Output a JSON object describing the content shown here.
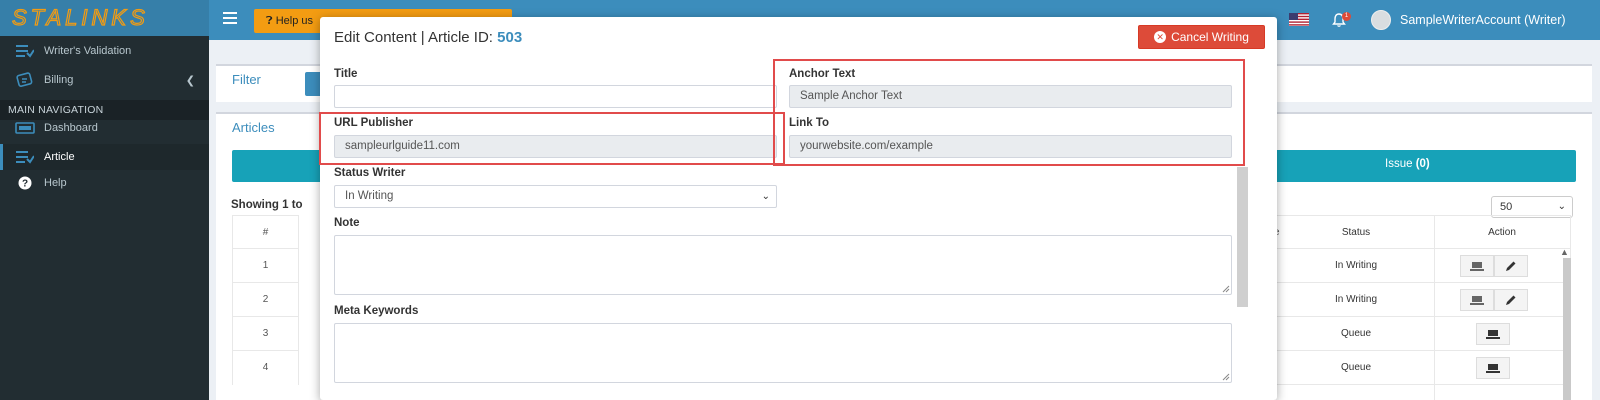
{
  "brand": {
    "logo_text": "STALINKS",
    "logo_color": "#f39c12"
  },
  "sidebar": {
    "items_top": [
      {
        "label": "Writer's Validation",
        "icon": "list-check-icon"
      },
      {
        "label": "Billing",
        "icon": "billing-icon"
      }
    ],
    "section_header": "MAIN NAVIGATION",
    "items_main": [
      {
        "label": "Dashboard",
        "icon": "dashboard-icon"
      },
      {
        "label": "Article",
        "icon": "list-check-icon",
        "active": true
      },
      {
        "label": "Help",
        "icon": "question-icon"
      }
    ]
  },
  "topbar": {
    "help_button_label": "Help us",
    "notification_count": "1",
    "user_name": "SampleWriterAccount (Writer)"
  },
  "background": {
    "filter_label": "Filter",
    "articles_label": "Articles",
    "issue_label": "Issue",
    "issue_count": "(0)",
    "showing_text": "Showing 1 to",
    "per_page": "50",
    "table": {
      "header_left": "#",
      "header_fragment": "e",
      "header_status": "Status",
      "header_action": "Action",
      "rows": [
        {
          "num": "1",
          "status": "In Writing"
        },
        {
          "num": "2",
          "status": "In Writing"
        },
        {
          "num": "3",
          "status": "Queue"
        },
        {
          "num": "4",
          "status": "Queue"
        }
      ]
    }
  },
  "modal": {
    "title_prefix": "Edit Content | Article ID: ",
    "article_id": "503",
    "cancel_label": "Cancel Writing",
    "fields": {
      "title_label": "Title",
      "title_value": "",
      "anchor_label": "Anchor Text",
      "anchor_value": "Sample Anchor Text",
      "url_publisher_label": "URL Publisher",
      "url_publisher_value": "sampleurlguide11.com",
      "link_to_label": "Link To",
      "link_to_value": "yourwebsite.com/example",
      "status_writer_label": "Status Writer",
      "status_writer_value": "In Writing",
      "note_label": "Note",
      "meta_keywords_label": "Meta Keywords"
    }
  },
  "colors": {
    "topbar": "#3c8dbc",
    "sidebar": "#222d32",
    "danger": "#dd4b39",
    "info": "#17a2b8",
    "highlight": "#e14b4b"
  }
}
